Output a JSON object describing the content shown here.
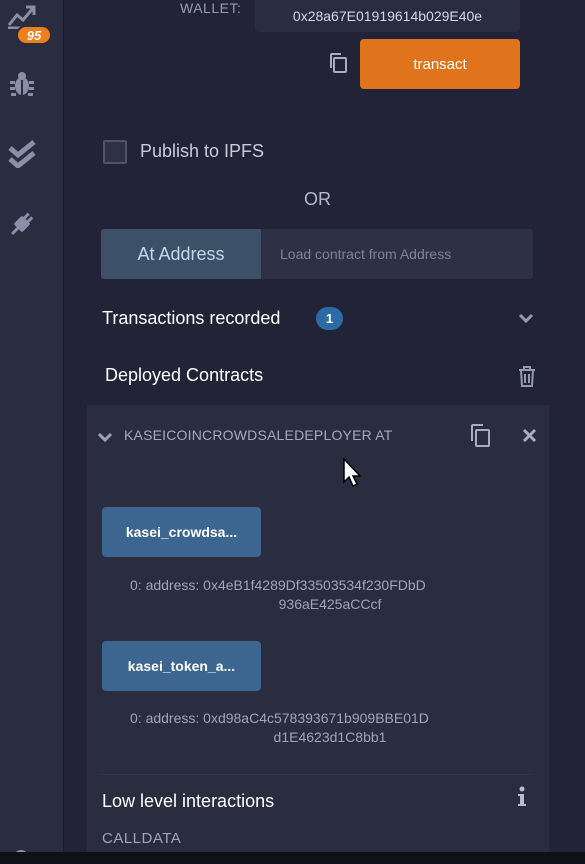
{
  "sidebar": {
    "badge_count": "95",
    "icons": [
      "chart-icon",
      "bug-icon",
      "double-check-icon",
      "plug-icon"
    ]
  },
  "run": {
    "wallet_label": "WALLET:",
    "wallet_value": "0x28a67E01919614b029E40e",
    "transact_label": "transact",
    "publish_label": "Publish to IPFS",
    "or_label": "OR",
    "at_address_label": "At Address",
    "address_placeholder": "Load contract from Address",
    "transactions_label": "Transactions recorded",
    "transactions_count": "1",
    "deployed_label": "Deployed Contracts"
  },
  "contract": {
    "name": "KASEICOINCROWDSALEDEPLOYER AT",
    "functions": [
      {
        "label": "kasei_crowdsa...",
        "result_line1": "0:  address: 0x4eB1f4289Df33503534f230FDbD",
        "result_line2": "936aE425aCCcf"
      },
      {
        "label": "kasei_token_a...",
        "result_line1": "0:  address: 0xd98aC4c578393671b909BBE01D",
        "result_line2": "d1E4623d1C8bb1"
      }
    ],
    "low_level_label": "Low level interactions",
    "calldata_label": "CALLDATA"
  },
  "colors": {
    "background": "#222336",
    "panel": "#2a2c3f",
    "accent_orange": "#e0741c",
    "function_button": "#3c6590"
  }
}
